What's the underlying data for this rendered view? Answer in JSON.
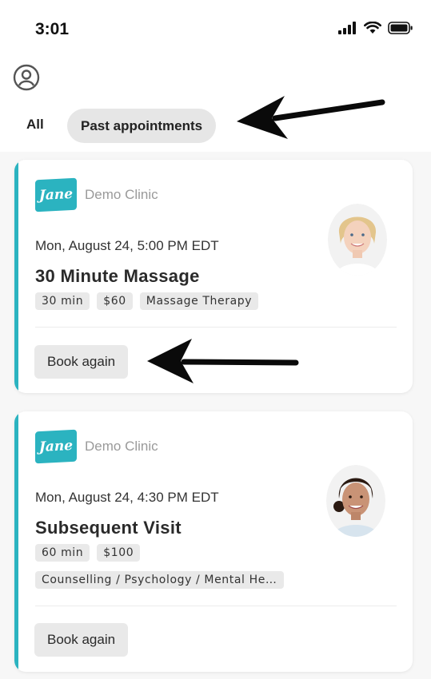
{
  "status_bar": {
    "time": "3:01"
  },
  "header": {
    "tabs": [
      {
        "label": "All"
      },
      {
        "label": "Past appointments",
        "selected": true
      }
    ]
  },
  "appointments": [
    {
      "clinic": "Demo Clinic",
      "logo_text": "Jane",
      "datetime": "Mon, August 24, 5:00 PM EDT",
      "title": "30 Minute Massage",
      "tags": [
        "30 min",
        "$60",
        "Massage Therapy"
      ],
      "action_label": "Book again"
    },
    {
      "clinic": "Demo Clinic",
      "logo_text": "Jane",
      "datetime": "Mon, August 24, 4:30 PM EDT",
      "title": "Subsequent Visit",
      "tags": [
        "60 min",
        "$100",
        "Counselling / Psychology / Mental He…"
      ],
      "action_label": "Book again"
    }
  ],
  "colors": {
    "accent": "#2bb3c0",
    "chip": "#e6e6e6"
  },
  "icons": [
    "signal-icon",
    "wifi-icon",
    "battery-icon",
    "profile-icon",
    "arrow-icon"
  ]
}
